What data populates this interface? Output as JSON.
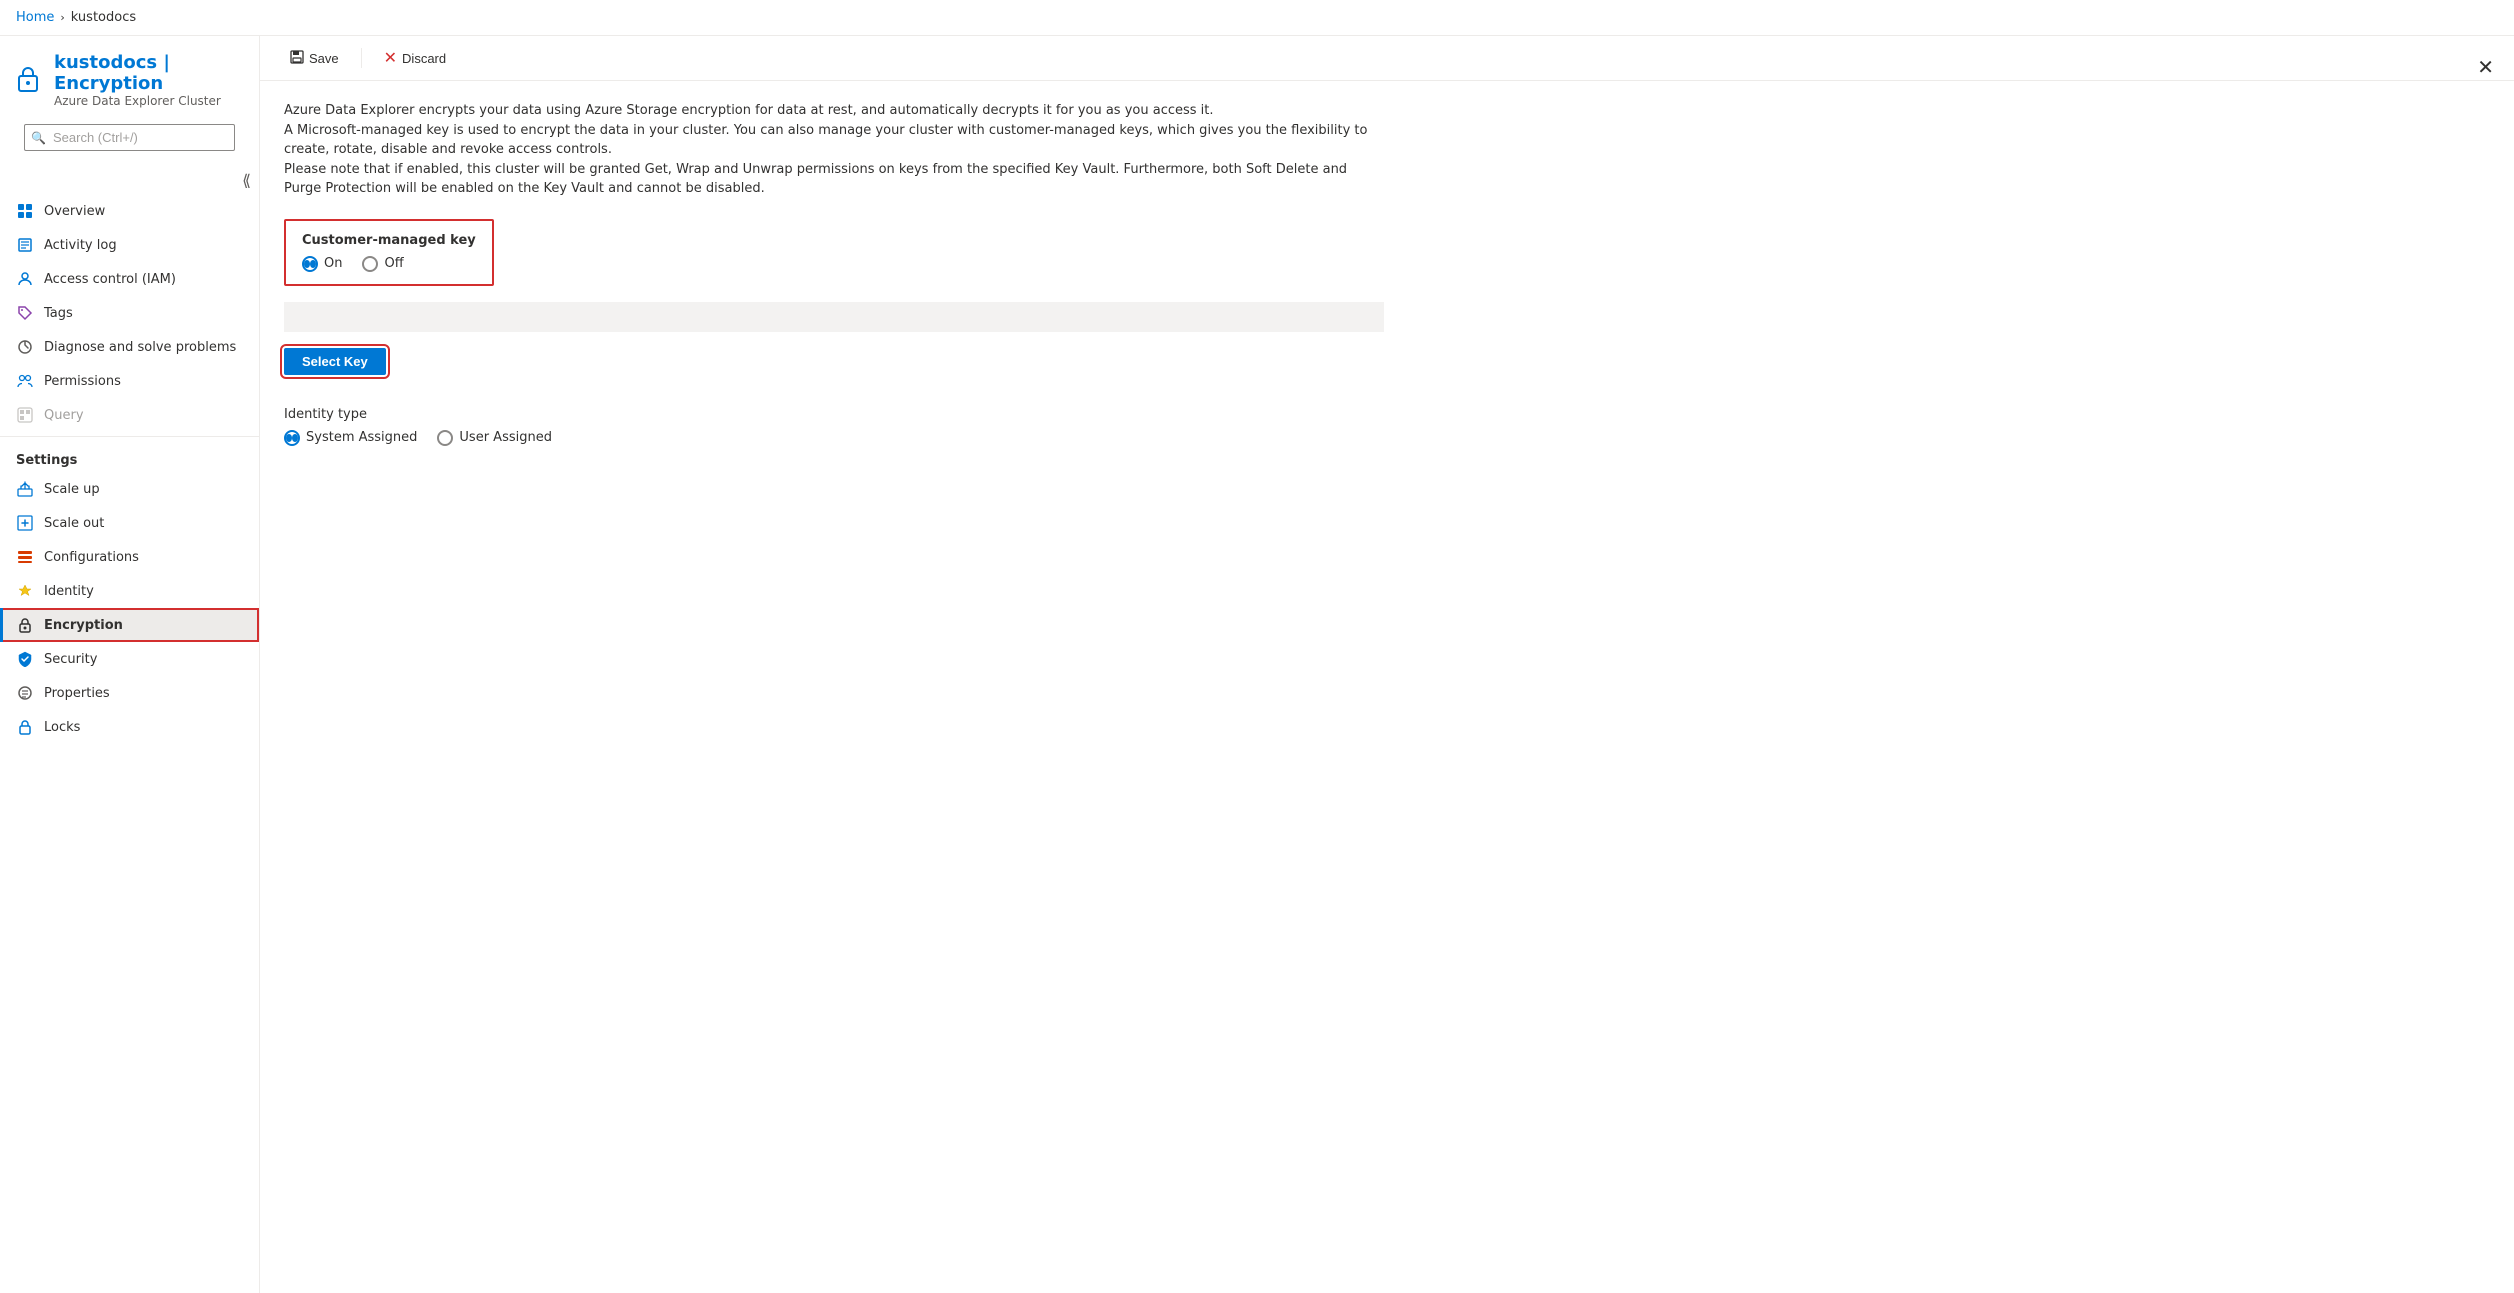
{
  "breadcrumb": {
    "home": "Home",
    "separator": ">",
    "current": "kustodocs"
  },
  "resource": {
    "title": "kustodocs | Encryption",
    "subtitle": "Azure Data Explorer Cluster",
    "icon": "lock"
  },
  "search": {
    "placeholder": "Search (Ctrl+/)"
  },
  "toolbar": {
    "save_label": "Save",
    "discard_label": "Discard"
  },
  "description": {
    "line1": "Azure Data Explorer encrypts your data using Azure Storage encryption for data at rest, and automatically decrypts it for you as you access it.",
    "line2": "A Microsoft-managed key is used to encrypt the data in your cluster. You can also manage your cluster with customer-managed keys, which gives you the flexibility to create, rotate, disable and revoke access controls.",
    "line3": "Please note that if enabled, this cluster will be granted Get, Wrap and Unwrap permissions on keys from the specified Key Vault. Furthermore, both Soft Delete and Purge Protection will be enabled on the Key Vault and cannot be disabled."
  },
  "customer_managed_key": {
    "label": "Customer-managed key",
    "on_label": "On",
    "off_label": "Off",
    "selected": "on"
  },
  "select_key_button": "Select Key",
  "identity_type": {
    "label": "Identity type",
    "system_assigned": "System Assigned",
    "user_assigned": "User Assigned",
    "selected": "system"
  },
  "sidebar": {
    "nav_items": [
      {
        "id": "overview",
        "label": "Overview",
        "icon": "grid",
        "active": false,
        "disabled": false
      },
      {
        "id": "activity-log",
        "label": "Activity log",
        "icon": "list",
        "active": false,
        "disabled": false
      },
      {
        "id": "access-control",
        "label": "Access control (IAM)",
        "icon": "person",
        "active": false,
        "disabled": false
      },
      {
        "id": "tags",
        "label": "Tags",
        "icon": "tag",
        "active": false,
        "disabled": false
      },
      {
        "id": "diagnose",
        "label": "Diagnose and solve problems",
        "icon": "wrench",
        "active": false,
        "disabled": false
      },
      {
        "id": "permissions",
        "label": "Permissions",
        "icon": "person-group",
        "active": false,
        "disabled": false
      },
      {
        "id": "query",
        "label": "Query",
        "icon": "grid-small",
        "active": false,
        "disabled": true
      }
    ],
    "settings_label": "Settings",
    "settings_items": [
      {
        "id": "scale-up",
        "label": "Scale up",
        "icon": "scale-up",
        "active": false
      },
      {
        "id": "scale-out",
        "label": "Scale out",
        "icon": "scale-out",
        "active": false
      },
      {
        "id": "configurations",
        "label": "Configurations",
        "icon": "config",
        "active": false
      },
      {
        "id": "identity",
        "label": "Identity",
        "icon": "key-yellow",
        "active": false
      },
      {
        "id": "encryption",
        "label": "Encryption",
        "icon": "lock",
        "active": true
      },
      {
        "id": "security",
        "label": "Security",
        "icon": "shield",
        "active": false
      },
      {
        "id": "properties",
        "label": "Properties",
        "icon": "properties",
        "active": false
      },
      {
        "id": "locks",
        "label": "Locks",
        "icon": "lock-small",
        "active": false
      }
    ]
  }
}
